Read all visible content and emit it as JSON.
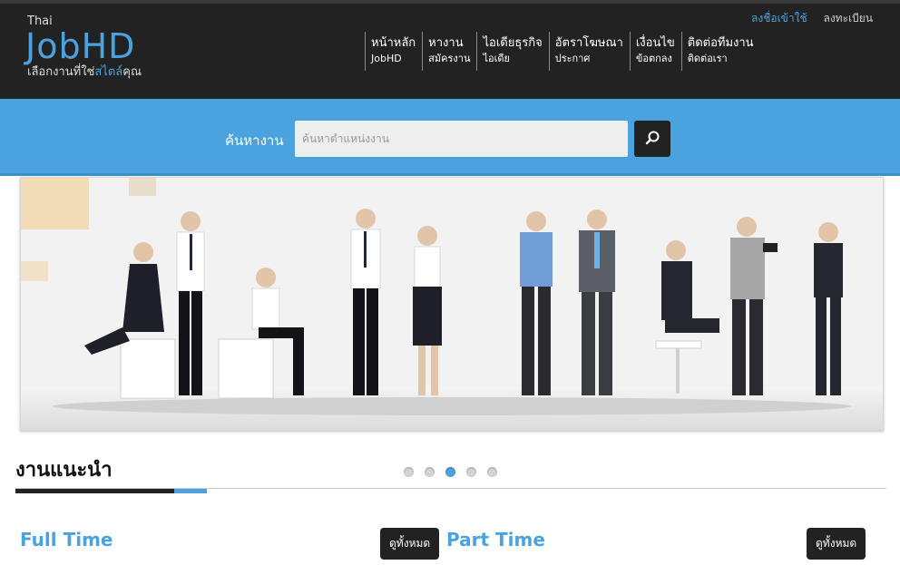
{
  "logo": {
    "small": "Thai",
    "big": "JobHD",
    "tagline_prefix": "เลือกงานที่ใช่",
    "tagline_accent": "สไตล์",
    "tagline_suffix": "คุณ"
  },
  "auth": {
    "login": "ลงชื่อเข้าใช้",
    "register": "ลงทะเบียน"
  },
  "nav": [
    {
      "main": "หน้าหลัก",
      "sub": "JobHD"
    },
    {
      "main": "หางาน",
      "sub": "สมัครงาน"
    },
    {
      "main": "ไอเดียธุรกิจ",
      "sub": "ไอเดีย"
    },
    {
      "main": "อัตราโฆษณา",
      "sub": "ประกาศ"
    },
    {
      "main": "เงื่อนไข",
      "sub": "ข้อตกลง"
    },
    {
      "main": "ติดต่อทีมงาน",
      "sub": "ติดต่อเรา"
    }
  ],
  "search": {
    "label": "ค้นหางาน",
    "placeholder": "ค้นหาตำแหน่งงาน",
    "value": "",
    "icon": "search-icon"
  },
  "banner": {
    "description": "business people group photo",
    "slides": 5,
    "active_slide": 3
  },
  "colors": {
    "accent": "#4aa3df",
    "dark": "#222222",
    "header": "#222222"
  },
  "section": {
    "title": "งานแนะนำ"
  },
  "categories": [
    {
      "title": "Full Time",
      "viewall": "ดูทั้งหมด"
    },
    {
      "title": "Part Time",
      "viewall": "ดูทั้งหมด"
    }
  ]
}
